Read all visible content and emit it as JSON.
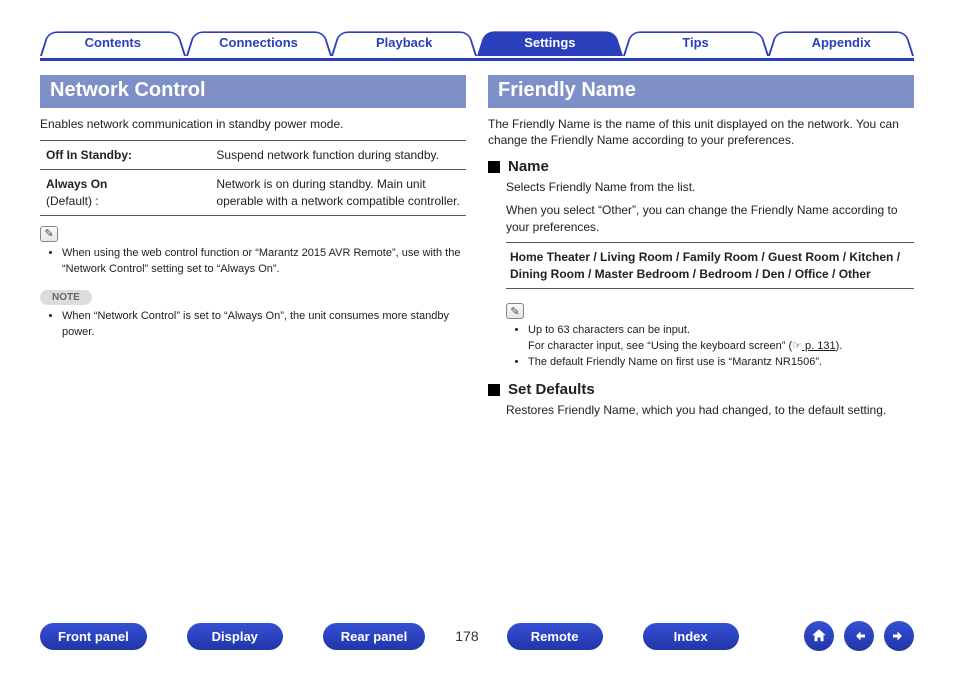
{
  "tabs": {
    "contents": "Contents",
    "connections": "Connections",
    "playback": "Playback",
    "settings": "Settings",
    "tips": "Tips",
    "appendix": "Appendix",
    "active": "settings"
  },
  "left": {
    "title": "Network Control",
    "intro": "Enables network communication in standby power mode.",
    "row1k": "Off In Standby:",
    "row1v": "Suspend network function during standby.",
    "row2k": "Always On",
    "row2ksub": "(Default) :",
    "row2v": "Network is on during standby. Main unit operable with a network compatible controller.",
    "tip1": "When using the web control function or “Marantz 2015 AVR Remote”, use with the “Network Control” setting set to “Always On”.",
    "noteLabel": "NOTE",
    "note1": "When “Network Control” is set to “Always On”, the unit consumes more standby power."
  },
  "right": {
    "title": "Friendly Name",
    "intro": "The Friendly Name is the name of this unit displayed on the network. You can change the Friendly Name according to your preferences.",
    "nameHeading": "Name",
    "nameBody1": "Selects Friendly Name from the list.",
    "nameBody2": "When you select “Other”, you can change the Friendly Name according to your preferences.",
    "options": "Home Theater / Living Room / Family Room / Guest Room / Kitchen / Dining Room / Master Bedroom / Bedroom / Den / Office / Other",
    "tip1a": "Up to 63 characters can be input.",
    "tip1b_pre": "For character input, see “Using the keyboard screen” (",
    "tip1b_link": " p. 131",
    "tip1b_post": ").",
    "tip2": "The default Friendly Name on first use is “Marantz NR1506”.",
    "setDefaultsHeading": "Set Defaults",
    "setDefaultsBody": "Restores Friendly Name, which you had changed, to the default setting."
  },
  "bottom": {
    "frontPanel": "Front panel",
    "display": "Display",
    "rearPanel": "Rear panel",
    "page": "178",
    "remote": "Remote",
    "index": "Index"
  }
}
